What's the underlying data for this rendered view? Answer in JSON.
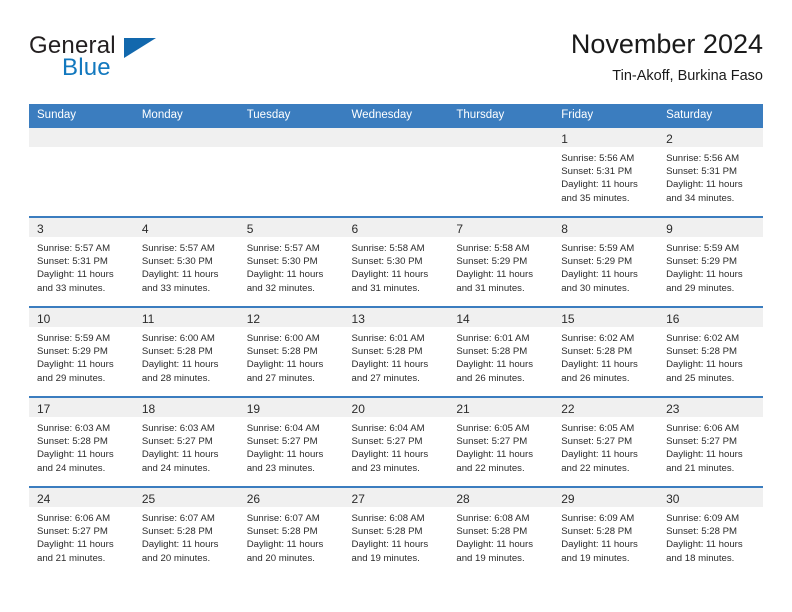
{
  "brand": {
    "name_top": "General",
    "name_bottom": "Blue",
    "triangle_color": "#1268ad",
    "blue_color": "#1278be"
  },
  "header": {
    "title": "November 2024",
    "subtitle": "Tin-Akoff, Burkina Faso"
  },
  "theme": {
    "header_bg": "#3b7dbf",
    "daynum_band_bg": "#f0f0f0",
    "text_color": "#2b2b2b"
  },
  "weekdays": [
    "Sunday",
    "Monday",
    "Tuesday",
    "Wednesday",
    "Thursday",
    "Friday",
    "Saturday"
  ],
  "weeks": [
    [
      {
        "day": "",
        "lines": []
      },
      {
        "day": "",
        "lines": []
      },
      {
        "day": "",
        "lines": []
      },
      {
        "day": "",
        "lines": []
      },
      {
        "day": "",
        "lines": []
      },
      {
        "day": "1",
        "lines": [
          "Sunrise: 5:56 AM",
          "Sunset: 5:31 PM",
          "Daylight: 11 hours",
          "and 35 minutes."
        ]
      },
      {
        "day": "2",
        "lines": [
          "Sunrise: 5:56 AM",
          "Sunset: 5:31 PM",
          "Daylight: 11 hours",
          "and 34 minutes."
        ]
      }
    ],
    [
      {
        "day": "3",
        "lines": [
          "Sunrise: 5:57 AM",
          "Sunset: 5:31 PM",
          "Daylight: 11 hours",
          "and 33 minutes."
        ]
      },
      {
        "day": "4",
        "lines": [
          "Sunrise: 5:57 AM",
          "Sunset: 5:30 PM",
          "Daylight: 11 hours",
          "and 33 minutes."
        ]
      },
      {
        "day": "5",
        "lines": [
          "Sunrise: 5:57 AM",
          "Sunset: 5:30 PM",
          "Daylight: 11 hours",
          "and 32 minutes."
        ]
      },
      {
        "day": "6",
        "lines": [
          "Sunrise: 5:58 AM",
          "Sunset: 5:30 PM",
          "Daylight: 11 hours",
          "and 31 minutes."
        ]
      },
      {
        "day": "7",
        "lines": [
          "Sunrise: 5:58 AM",
          "Sunset: 5:29 PM",
          "Daylight: 11 hours",
          "and 31 minutes."
        ]
      },
      {
        "day": "8",
        "lines": [
          "Sunrise: 5:59 AM",
          "Sunset: 5:29 PM",
          "Daylight: 11 hours",
          "and 30 minutes."
        ]
      },
      {
        "day": "9",
        "lines": [
          "Sunrise: 5:59 AM",
          "Sunset: 5:29 PM",
          "Daylight: 11 hours",
          "and 29 minutes."
        ]
      }
    ],
    [
      {
        "day": "10",
        "lines": [
          "Sunrise: 5:59 AM",
          "Sunset: 5:29 PM",
          "Daylight: 11 hours",
          "and 29 minutes."
        ]
      },
      {
        "day": "11",
        "lines": [
          "Sunrise: 6:00 AM",
          "Sunset: 5:28 PM",
          "Daylight: 11 hours",
          "and 28 minutes."
        ]
      },
      {
        "day": "12",
        "lines": [
          "Sunrise: 6:00 AM",
          "Sunset: 5:28 PM",
          "Daylight: 11 hours",
          "and 27 minutes."
        ]
      },
      {
        "day": "13",
        "lines": [
          "Sunrise: 6:01 AM",
          "Sunset: 5:28 PM",
          "Daylight: 11 hours",
          "and 27 minutes."
        ]
      },
      {
        "day": "14",
        "lines": [
          "Sunrise: 6:01 AM",
          "Sunset: 5:28 PM",
          "Daylight: 11 hours",
          "and 26 minutes."
        ]
      },
      {
        "day": "15",
        "lines": [
          "Sunrise: 6:02 AM",
          "Sunset: 5:28 PM",
          "Daylight: 11 hours",
          "and 26 minutes."
        ]
      },
      {
        "day": "16",
        "lines": [
          "Sunrise: 6:02 AM",
          "Sunset: 5:28 PM",
          "Daylight: 11 hours",
          "and 25 minutes."
        ]
      }
    ],
    [
      {
        "day": "17",
        "lines": [
          "Sunrise: 6:03 AM",
          "Sunset: 5:28 PM",
          "Daylight: 11 hours",
          "and 24 minutes."
        ]
      },
      {
        "day": "18",
        "lines": [
          "Sunrise: 6:03 AM",
          "Sunset: 5:27 PM",
          "Daylight: 11 hours",
          "and 24 minutes."
        ]
      },
      {
        "day": "19",
        "lines": [
          "Sunrise: 6:04 AM",
          "Sunset: 5:27 PM",
          "Daylight: 11 hours",
          "and 23 minutes."
        ]
      },
      {
        "day": "20",
        "lines": [
          "Sunrise: 6:04 AM",
          "Sunset: 5:27 PM",
          "Daylight: 11 hours",
          "and 23 minutes."
        ]
      },
      {
        "day": "21",
        "lines": [
          "Sunrise: 6:05 AM",
          "Sunset: 5:27 PM",
          "Daylight: 11 hours",
          "and 22 minutes."
        ]
      },
      {
        "day": "22",
        "lines": [
          "Sunrise: 6:05 AM",
          "Sunset: 5:27 PM",
          "Daylight: 11 hours",
          "and 22 minutes."
        ]
      },
      {
        "day": "23",
        "lines": [
          "Sunrise: 6:06 AM",
          "Sunset: 5:27 PM",
          "Daylight: 11 hours",
          "and 21 minutes."
        ]
      }
    ],
    [
      {
        "day": "24",
        "lines": [
          "Sunrise: 6:06 AM",
          "Sunset: 5:27 PM",
          "Daylight: 11 hours",
          "and 21 minutes."
        ]
      },
      {
        "day": "25",
        "lines": [
          "Sunrise: 6:07 AM",
          "Sunset: 5:28 PM",
          "Daylight: 11 hours",
          "and 20 minutes."
        ]
      },
      {
        "day": "26",
        "lines": [
          "Sunrise: 6:07 AM",
          "Sunset: 5:28 PM",
          "Daylight: 11 hours",
          "and 20 minutes."
        ]
      },
      {
        "day": "27",
        "lines": [
          "Sunrise: 6:08 AM",
          "Sunset: 5:28 PM",
          "Daylight: 11 hours",
          "and 19 minutes."
        ]
      },
      {
        "day": "28",
        "lines": [
          "Sunrise: 6:08 AM",
          "Sunset: 5:28 PM",
          "Daylight: 11 hours",
          "and 19 minutes."
        ]
      },
      {
        "day": "29",
        "lines": [
          "Sunrise: 6:09 AM",
          "Sunset: 5:28 PM",
          "Daylight: 11 hours",
          "and 19 minutes."
        ]
      },
      {
        "day": "30",
        "lines": [
          "Sunrise: 6:09 AM",
          "Sunset: 5:28 PM",
          "Daylight: 11 hours",
          "and 18 minutes."
        ]
      }
    ]
  ]
}
